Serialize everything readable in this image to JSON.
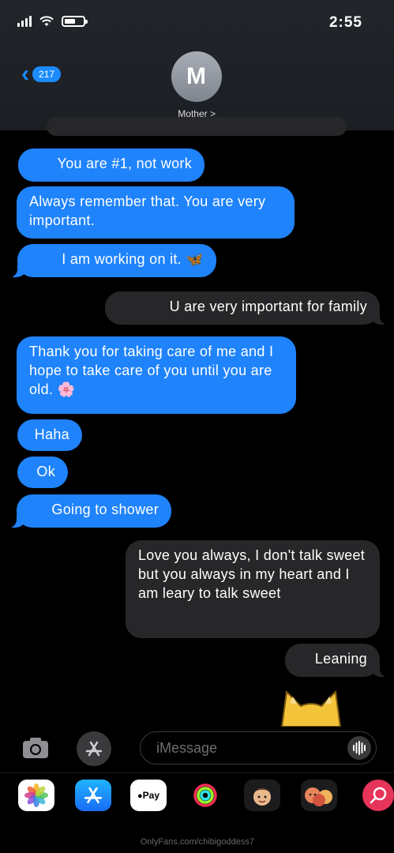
{
  "status": {
    "time": "2:55"
  },
  "header": {
    "back_count": "217",
    "avatar_initial": "M",
    "contact_name": "Mother >"
  },
  "messages": [
    {
      "side": "left",
      "text": "You are #1, not work"
    },
    {
      "side": "left",
      "text": "Always remember that. You are very important."
    },
    {
      "side": "left",
      "text": "I am working on it. 🦋"
    },
    {
      "side": "right",
      "text": "U are very important for family"
    },
    {
      "side": "left",
      "text": "Thank you for taking care of me and I hope to take care of you until you are old. 🌸"
    },
    {
      "side": "left",
      "text": "Haha"
    },
    {
      "side": "left",
      "text": "Ok"
    },
    {
      "side": "left",
      "text": "Going to shower"
    },
    {
      "side": "right",
      "text": "Love you always, I don't talk sweet but you always in my heart and I am leary to talk sweet"
    },
    {
      "side": "right",
      "text": "Leaning"
    }
  ],
  "input": {
    "placeholder": "iMessage"
  },
  "tray": {
    "apps": [
      {
        "name": "photos-icon"
      },
      {
        "name": "app-store-icon"
      },
      {
        "name": "apple-pay-icon",
        "label": "Pay"
      },
      {
        "name": "activity-icon"
      },
      {
        "name": "memoji-icon"
      },
      {
        "name": "memoji-stickers-icon"
      },
      {
        "name": "web-search-icon"
      }
    ]
  },
  "watermark": "OnlyFans.com/chibigoddess7",
  "colors": {
    "blue": "#1f83fb",
    "gray_bubble": "#27272a",
    "accent": "#1c8bff"
  }
}
